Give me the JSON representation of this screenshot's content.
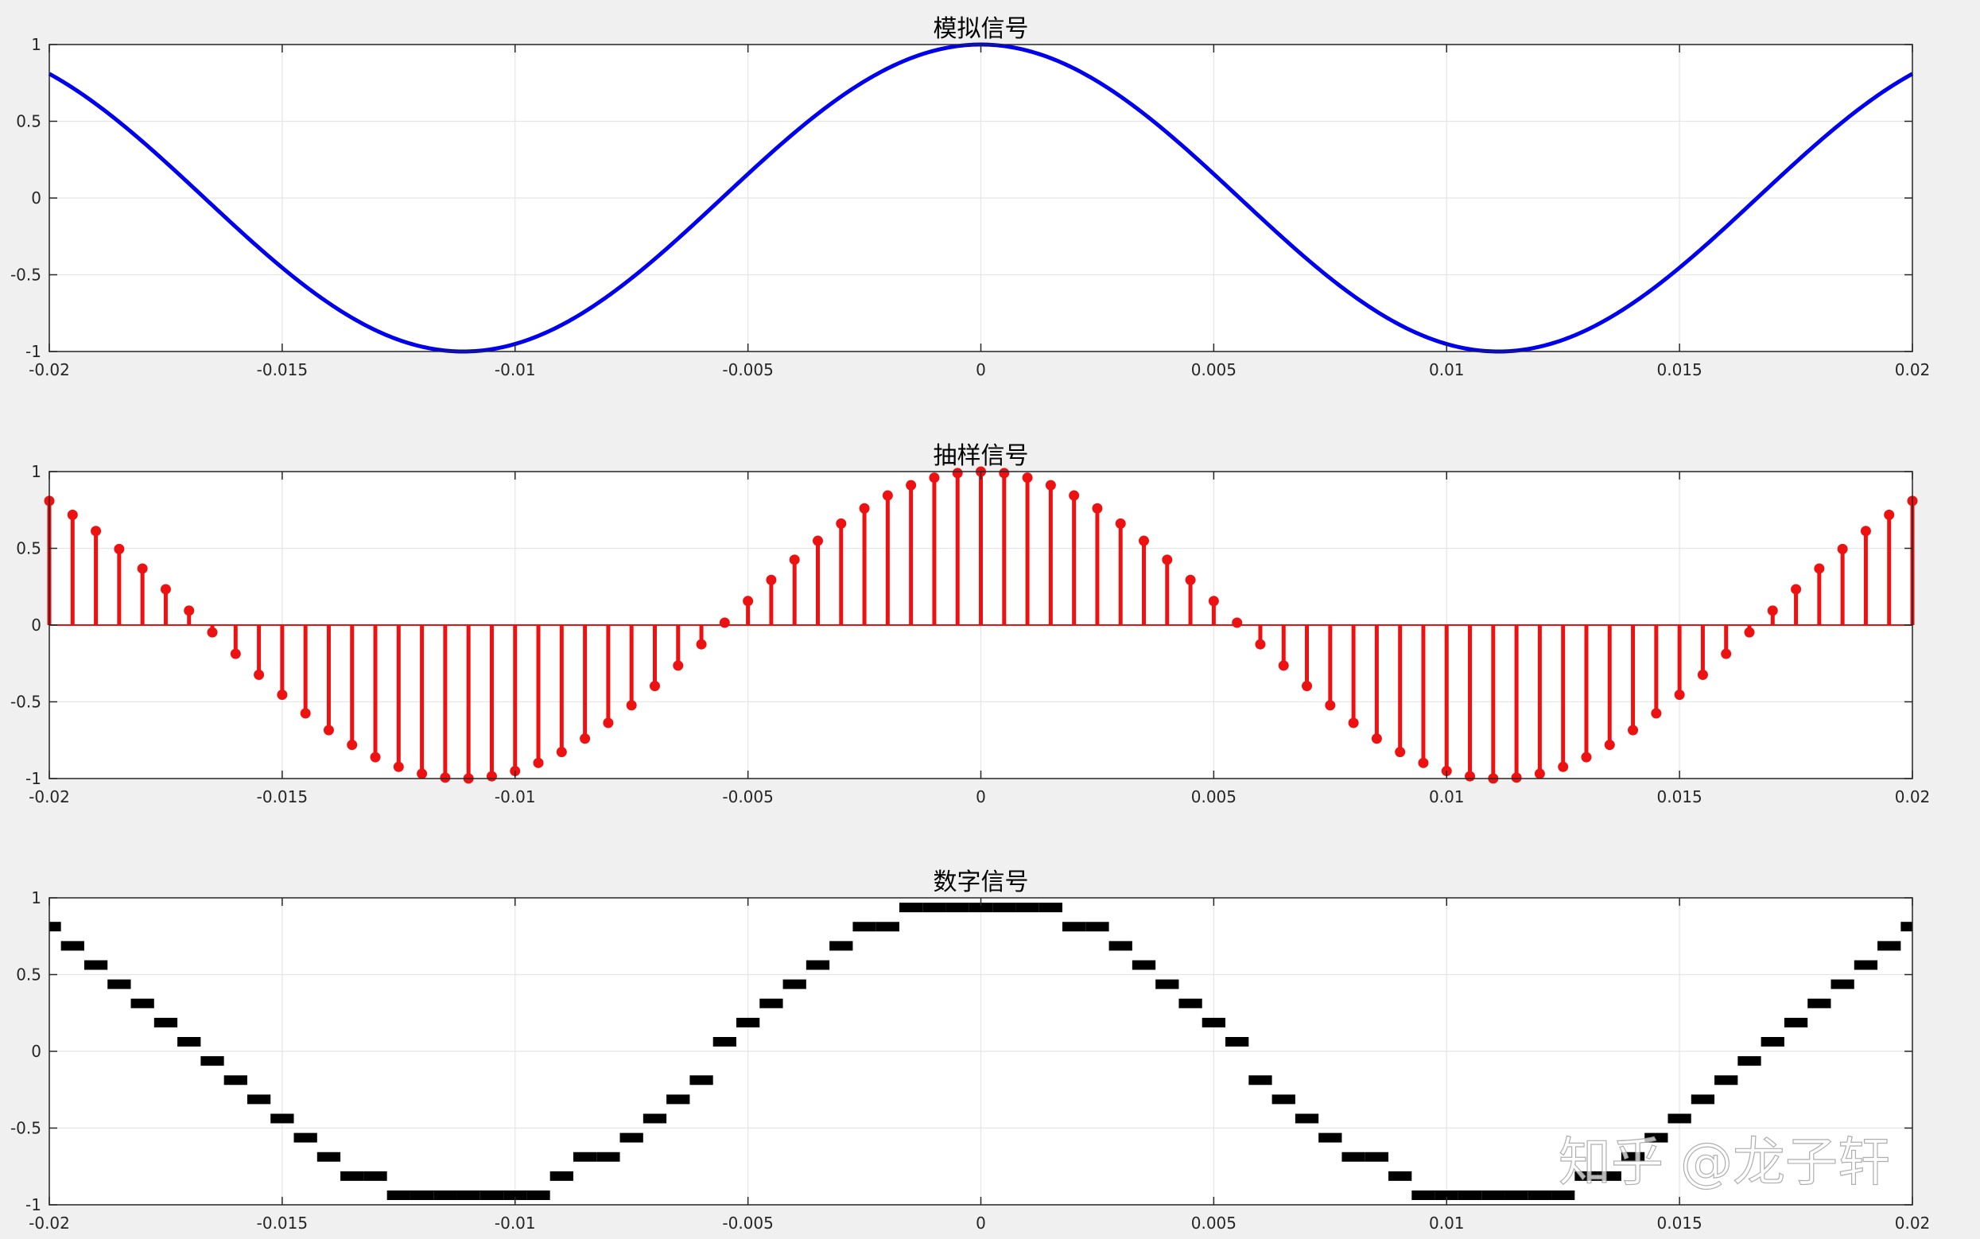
{
  "colors": {
    "background": "#f0f0f0",
    "axes_bg": "#ffffff",
    "grid": "#e5e5e5",
    "axis": "#262626",
    "analog": "#0000ee",
    "sampled": "#ee1111",
    "digital": "#000000"
  },
  "watermark": "知乎 @龙子轩",
  "chart_data": [
    {
      "type": "line",
      "title": "模拟信号",
      "signal": "cos(2*pi*45*t)",
      "frequency_hz": 45,
      "x_range": [
        -0.02,
        0.02
      ],
      "xlim": [
        -0.02,
        0.02
      ],
      "ylim": [
        -1,
        1
      ],
      "xticks": [
        "-0.02",
        "-0.015",
        "-0.01",
        "-0.005",
        "0",
        "0.005",
        "0.01",
        "0.015",
        "0.02"
      ],
      "yticks": [
        "1",
        "0.5",
        "0",
        "-0.5",
        "-1"
      ],
      "grid": true,
      "color": "#0000ee"
    },
    {
      "type": "stem",
      "title": "抽样信号",
      "signal": "cos(2*pi*45*t)",
      "frequency_hz": 45,
      "sample_interval": 0.0005,
      "x_range": [
        -0.02,
        0.02
      ],
      "xlim": [
        -0.02,
        0.02
      ],
      "ylim": [
        -1,
        1
      ],
      "xticks": [
        "-0.02",
        "-0.015",
        "-0.01",
        "-0.005",
        "0",
        "0.005",
        "0.01",
        "0.015",
        "0.02"
      ],
      "yticks": [
        "1",
        "0.5",
        "0",
        "-0.5",
        "-1"
      ],
      "grid": true,
      "color": "#ee1111"
    },
    {
      "type": "step",
      "title": "数字信号",
      "signal": "quantized cos(2*pi*45*t)",
      "frequency_hz": 45,
      "sample_interval": 0.0005,
      "levels": [
        -0.9375,
        -0.8125,
        -0.6875,
        -0.5625,
        -0.4375,
        -0.3125,
        -0.1875,
        -0.0625,
        0.0625,
        0.1875,
        0.3125,
        0.4375,
        0.5625,
        0.6875,
        0.8125,
        0.9375
      ],
      "x_range": [
        -0.02,
        0.02
      ],
      "xlim": [
        -0.02,
        0.02
      ],
      "ylim": [
        -1,
        1
      ],
      "xticks": [
        "-0.02",
        "-0.015",
        "-0.01",
        "-0.005",
        "0",
        "0.005",
        "0.01",
        "0.015",
        "0.02"
      ],
      "yticks": [
        "1",
        "0.5",
        "0",
        "-0.5",
        "-1"
      ],
      "grid": true,
      "color": "#000000"
    }
  ]
}
